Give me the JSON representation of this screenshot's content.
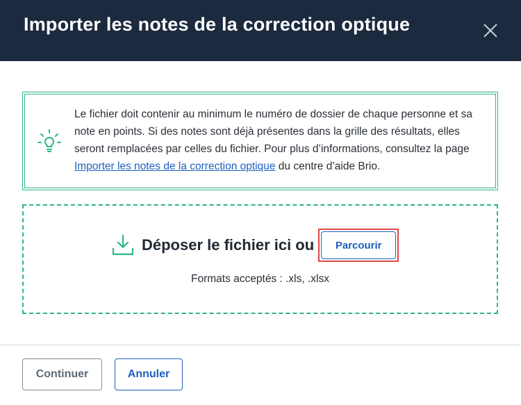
{
  "dialog": {
    "title": "Importer les notes de la correction optique",
    "close_icon": "close-icon"
  },
  "info": {
    "icon": "lightbulb-icon",
    "text_before_link": "Le fichier doit contenir au minimum le numéro de dossier de chaque personne et sa note en points. Si des notes sont déjà présentes dans la grille des résultats, elles seront remplacées par celles du fichier. Pour plus d’informations, consultez la page ",
    "link_text": "Importer les notes de la correction optique",
    "text_after_link": " du centre d’aide Brio."
  },
  "dropzone": {
    "icon": "download-icon",
    "label": "Déposer le fichier ici ou",
    "browse_label": "Parcourir",
    "formats": "Formats acceptés : .xls, .xlsx"
  },
  "footer": {
    "continue_label": "Continuer",
    "cancel_label": "Annuler"
  },
  "colors": {
    "header_bg": "#1b2a3e",
    "accent_green": "#2bb58a",
    "link_blue": "#1f5fbf",
    "highlight_red": "#e04848"
  }
}
